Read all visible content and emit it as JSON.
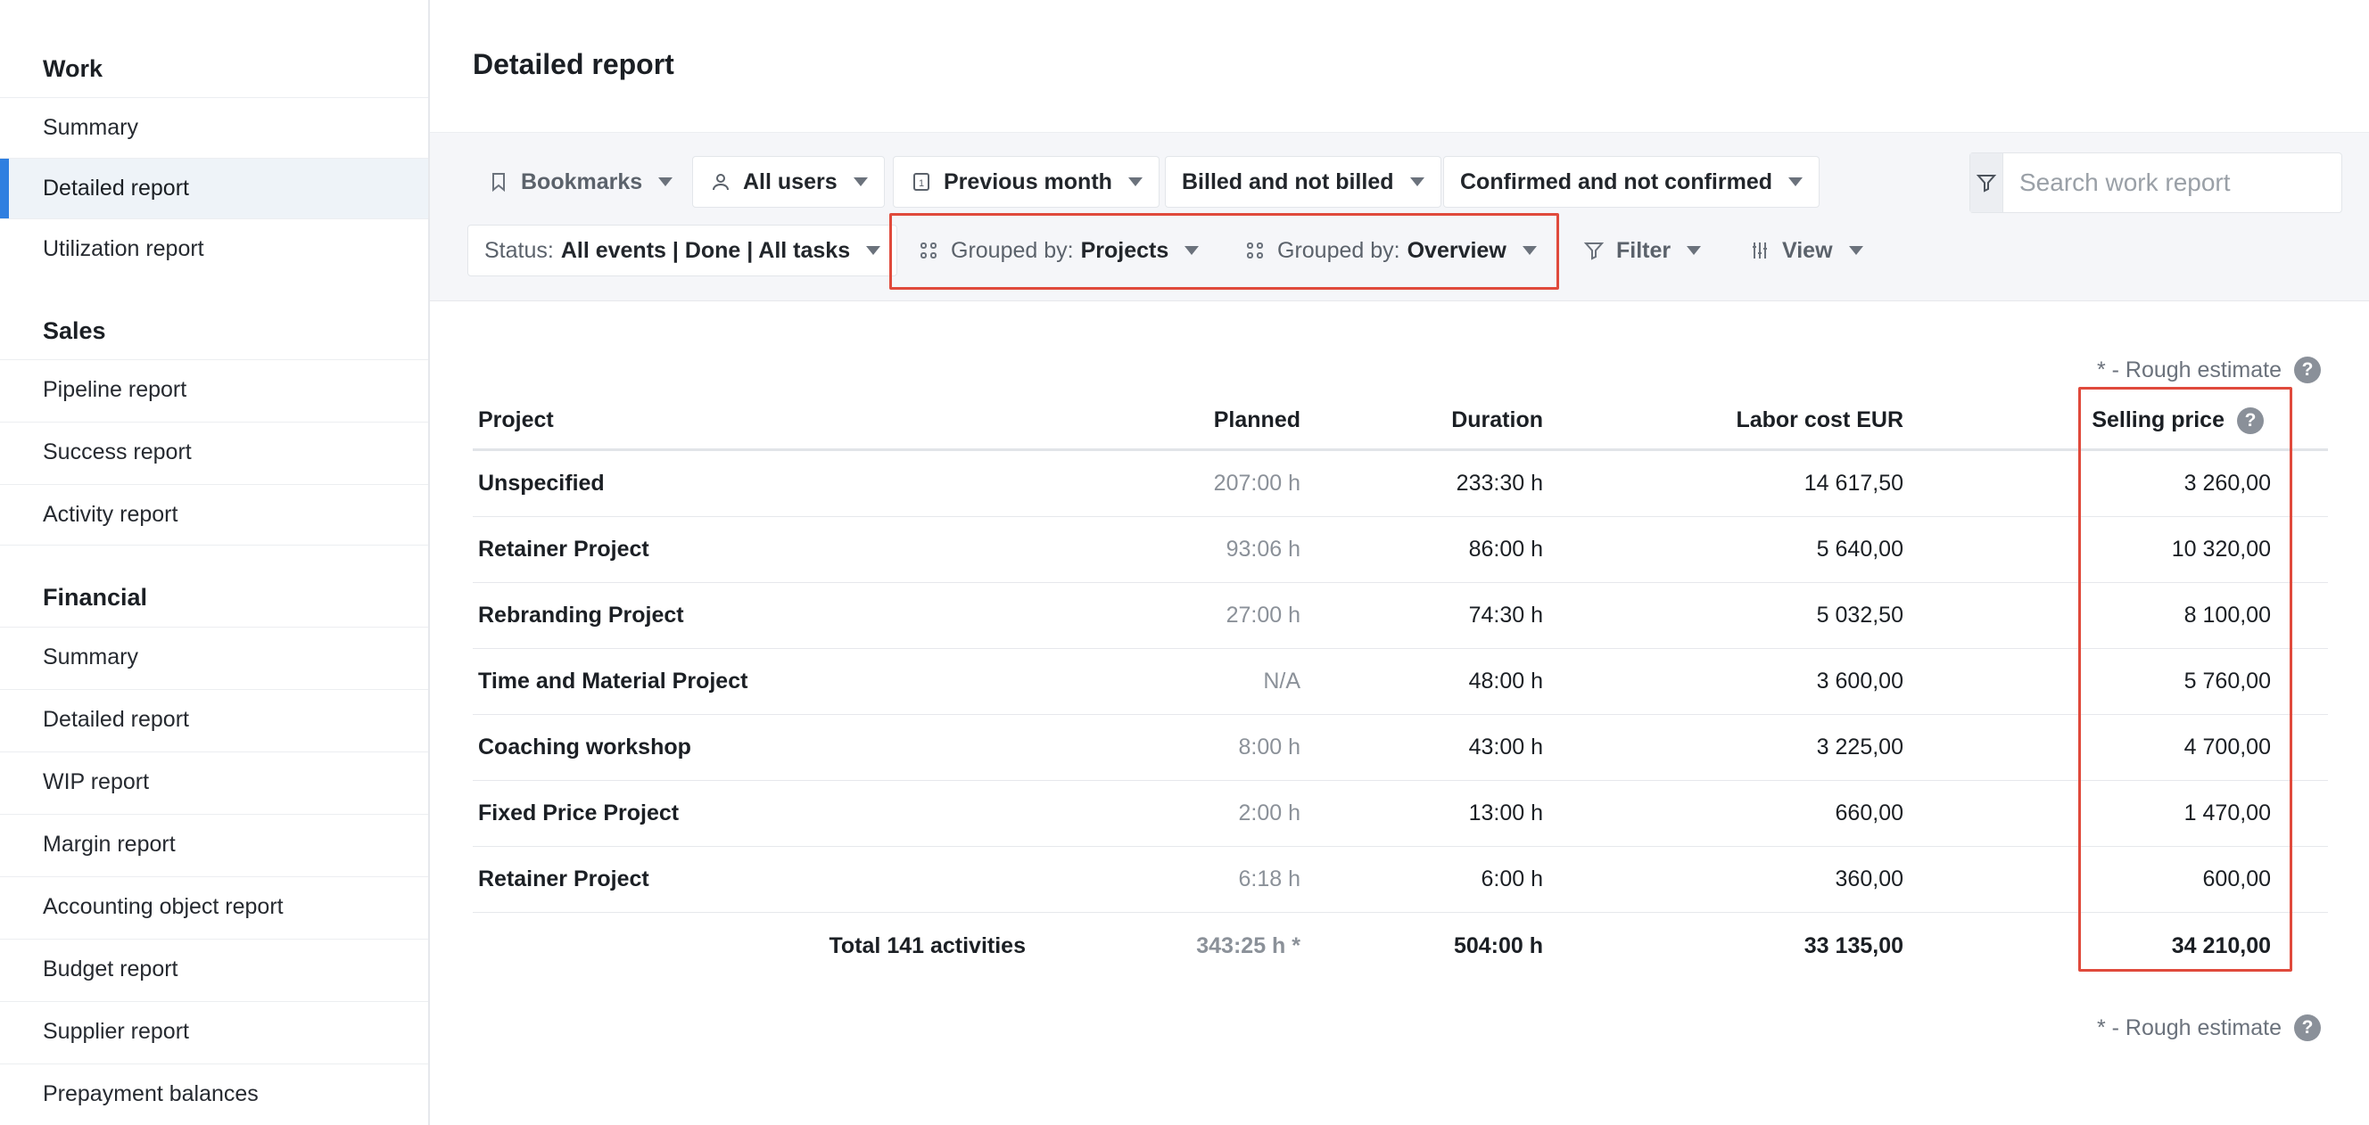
{
  "sidebar": {
    "work": {
      "title": "Work",
      "items": [
        "Summary",
        "Detailed report",
        "Utilization report"
      ]
    },
    "sales": {
      "title": "Sales",
      "items": [
        "Pipeline report",
        "Success report",
        "Activity report"
      ]
    },
    "financial": {
      "title": "Financial",
      "items": [
        "Summary",
        "Detailed report",
        "WIP report",
        "Margin report",
        "Accounting object report",
        "Budget report",
        "Supplier report",
        "Prepayment balances"
      ]
    }
  },
  "page_title": "Detailed report",
  "toolbar": {
    "bookmarks": "Bookmarks",
    "users": "All users",
    "period": "Previous month",
    "period_icon_number": "1",
    "billed": "Billed and not billed",
    "confirmed": "Confirmed and not confirmed",
    "status_prefix": "Status:",
    "status_value": "All events | Done | All tasks",
    "group1_prefix": "Grouped by:",
    "group1_value": "Projects",
    "group2_prefix": "Grouped by:",
    "group2_value": "Overview",
    "filter": "Filter",
    "view": "View"
  },
  "search": {
    "placeholder": "Search work report"
  },
  "rough_estimate": "* - Rough estimate",
  "table": {
    "headers": {
      "project": "Project",
      "planned": "Planned",
      "duration": "Duration",
      "labor": "Labor cost EUR",
      "price": "Selling price"
    },
    "rows": [
      {
        "project": "Unspecified",
        "planned": "207:00 h",
        "duration": "233:30 h",
        "labor": "14 617,50",
        "price": "3 260,00"
      },
      {
        "project": "Retainer Project",
        "planned": "93:06 h",
        "duration": "86:00 h",
        "labor": "5 640,00",
        "price": "10 320,00"
      },
      {
        "project": "Rebranding Project",
        "planned": "27:00 h",
        "duration": "74:30 h",
        "labor": "5 032,50",
        "price": "8 100,00"
      },
      {
        "project": "Time and Material Project",
        "planned": "N/A",
        "duration": "48:00 h",
        "labor": "3 600,00",
        "price": "5 760,00"
      },
      {
        "project": "Coaching workshop",
        "planned": "8:00 h",
        "duration": "43:00 h",
        "labor": "3 225,00",
        "price": "4 700,00"
      },
      {
        "project": "Fixed Price Project",
        "planned": "2:00 h",
        "duration": "13:00 h",
        "labor": "660,00",
        "price": "1 470,00"
      },
      {
        "project": "Retainer Project",
        "planned": "6:18 h",
        "duration": "6:00 h",
        "labor": "360,00",
        "price": "600,00"
      }
    ],
    "total": {
      "label": "Total 141 activities",
      "planned": "343:25 h *",
      "duration": "504:00 h",
      "labor": "33 135,00",
      "price": "34 210,00"
    }
  },
  "colors": {
    "highlight": "#e04a3c",
    "active_accent": "#2f7fe0"
  }
}
